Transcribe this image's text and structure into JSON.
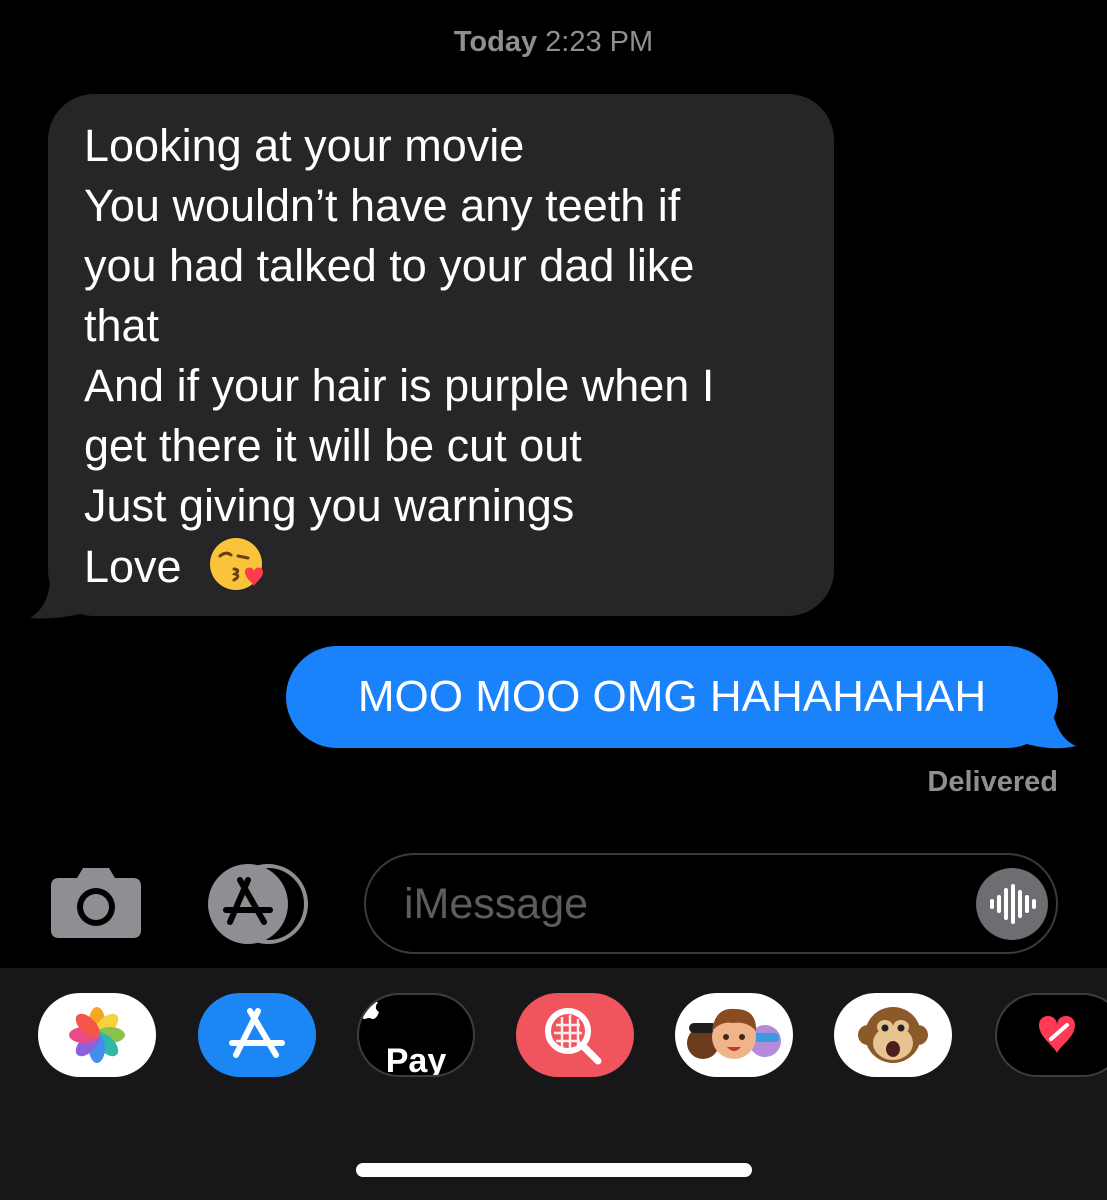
{
  "thread": {
    "timestamp_day": "Today",
    "timestamp_time": "2:23 PM",
    "incoming": {
      "lines": [
        "Looking at your movie",
        "You wouldn’t have any teeth if",
        "you had talked to your dad like",
        "that",
        "And if your hair is purple when I",
        "get there it will be cut out",
        "Just giving you warnings",
        "Love"
      ],
      "emoji": "face-blowing-a-kiss-icon"
    },
    "outgoing": {
      "text": "MOO MOO OMG HAHAHAHAH"
    },
    "status": "Delivered"
  },
  "compose": {
    "placeholder": "iMessage",
    "camera_icon": "camera-icon",
    "apps_icon": "app-store-icon",
    "audio_icon": "audio-waveform-icon"
  },
  "drawer": {
    "apps": [
      {
        "name": "photos-app-icon"
      },
      {
        "name": "app-store-app-icon"
      },
      {
        "name": "apple-pay-app-icon",
        "label": "Pay"
      },
      {
        "name": "images-search-app-icon"
      },
      {
        "name": "memoji-stickers-app-icon"
      },
      {
        "name": "animoji-monkey-app-icon"
      },
      {
        "name": "digital-touch-app-icon"
      }
    ]
  },
  "colors": {
    "background": "#000000",
    "incoming_bubble": "#262629",
    "outgoing_bubble": "#1a82fb",
    "secondary_text": "#8e8e93",
    "drawer": "#17171a"
  }
}
